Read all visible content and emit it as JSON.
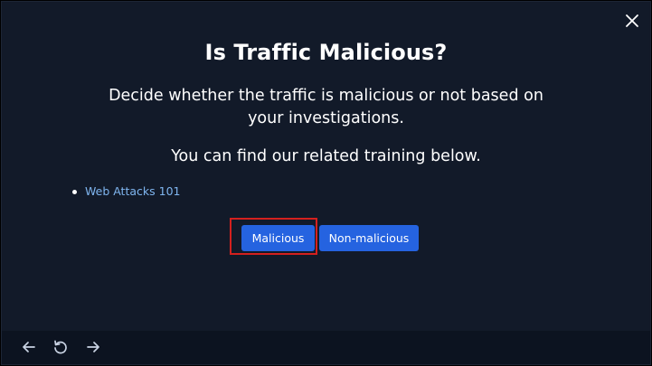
{
  "dialog": {
    "title": "Is Traffic Malicious?",
    "description": "Decide whether the traffic is malicious or not based on your investigations.",
    "subtext": "You can find our related training below.",
    "training_links": [
      {
        "label": "Web Attacks 101"
      }
    ],
    "buttons": {
      "malicious": "Malicious",
      "non_malicious": "Non-malicious"
    },
    "close_icon": "close-icon"
  },
  "nav": {
    "back_icon": "arrow-left-icon",
    "reload_icon": "reload-icon",
    "forward_icon": "arrow-right-icon"
  },
  "colors": {
    "background": "#121a29",
    "bottom_bar": "#0c1320",
    "button": "#2563e0",
    "link": "#7fb5ef",
    "highlight": "#d4201e"
  }
}
